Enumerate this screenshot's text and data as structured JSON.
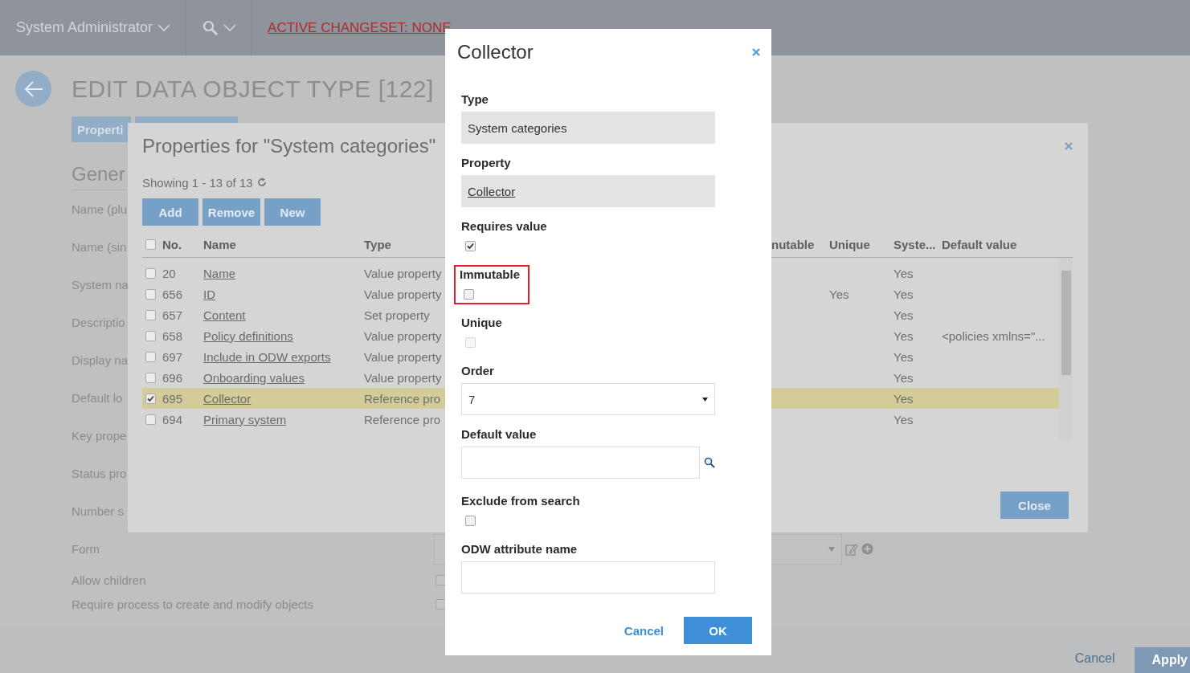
{
  "top_bar": {
    "user_menu": "System Administrator",
    "changeset_link": "ACTIVE CHANGESET: NONE"
  },
  "page": {
    "title": "EDIT DATA OBJECT TYPE [122]",
    "tabs": [
      {
        "label": "Properti",
        "selected": true
      }
    ],
    "section_heading": "Gener",
    "field_labels": [
      {
        "kind": "label",
        "label": "Name (plu"
      },
      {
        "kind": "label",
        "label": "Name (sin"
      },
      {
        "kind": "label",
        "label": "System na"
      },
      {
        "kind": "label",
        "label": "Descriptio"
      },
      {
        "kind": "label",
        "label": "Display na"
      },
      {
        "kind": "label",
        "label": "Default lo"
      },
      {
        "kind": "label",
        "label": "Key prope"
      },
      {
        "kind": "label",
        "label": "Status pro"
      },
      {
        "kind": "label",
        "label": "Number s"
      },
      {
        "kind": "select",
        "label": "Form"
      },
      {
        "kind": "checkbox",
        "label": "Allow children",
        "checked": false
      },
      {
        "kind": "checkbox",
        "label": "Require process to create and modify objects",
        "checked": false
      }
    ]
  },
  "footer": {
    "cancel": "Cancel",
    "apply": "Apply"
  },
  "properties_dialog": {
    "title": "Properties for \"System categories\"",
    "showing": "Showing 1 - 13 of 13",
    "buttons": [
      "Add",
      "Remove",
      "New"
    ],
    "select_all_checked": false,
    "columns": [
      "No.",
      "Name",
      "Type",
      "nutable",
      "Unique",
      "Syste...",
      "Default value"
    ],
    "rows": [
      {
        "checked": false,
        "selected": false,
        "no": "20",
        "name": "Name",
        "type": "Value property",
        "system": "Yes"
      },
      {
        "checked": false,
        "selected": false,
        "no": "656",
        "name": "ID",
        "type": "Value property",
        "unique": "Yes",
        "system": "Yes"
      },
      {
        "checked": false,
        "selected": false,
        "no": "657",
        "name": "Content",
        "type": "Set property",
        "system": "Yes"
      },
      {
        "checked": false,
        "selected": false,
        "no": "658",
        "name": "Policy definitions",
        "type": "Value property",
        "system": "Yes",
        "default_value": "<policies xmlns=\"..."
      },
      {
        "checked": false,
        "selected": false,
        "no": "697",
        "name": "Include in ODW exports",
        "type": "Value property",
        "system": "Yes"
      },
      {
        "checked": false,
        "selected": false,
        "no": "696",
        "name": "Onboarding values",
        "type": "Value property",
        "system": "Yes"
      },
      {
        "checked": true,
        "selected": true,
        "no": "695",
        "name": "Collector",
        "type": "Reference pro",
        "system": "Yes"
      },
      {
        "checked": false,
        "selected": false,
        "no": "694",
        "name": "Primary system",
        "type": "Reference pro",
        "system": "Yes"
      }
    ],
    "close_button": "Close"
  },
  "collector_dialog": {
    "title": "Collector",
    "fields": [
      {
        "kind": "readonly",
        "label": "Type",
        "value": "System categories"
      },
      {
        "kind": "readonly_link",
        "label": "Property",
        "value": "Collector"
      },
      {
        "kind": "checkbox",
        "label": "Requires value",
        "checked": true,
        "disabled": false,
        "highlighted": false
      },
      {
        "kind": "checkbox",
        "label": "Immutable",
        "checked": false,
        "disabled": false,
        "highlighted": true
      },
      {
        "kind": "checkbox",
        "label": "Unique",
        "checked": false,
        "disabled": true,
        "highlighted": false
      },
      {
        "kind": "select",
        "label": "Order",
        "value": "7"
      },
      {
        "kind": "lookup",
        "label": "Default value"
      },
      {
        "kind": "checkbox",
        "label": "Exclude from search",
        "checked": false,
        "disabled": false,
        "highlighted": false
      },
      {
        "kind": "text",
        "label": "ODW attribute name"
      }
    ],
    "cancel": "Cancel",
    "ok": "OK"
  }
}
